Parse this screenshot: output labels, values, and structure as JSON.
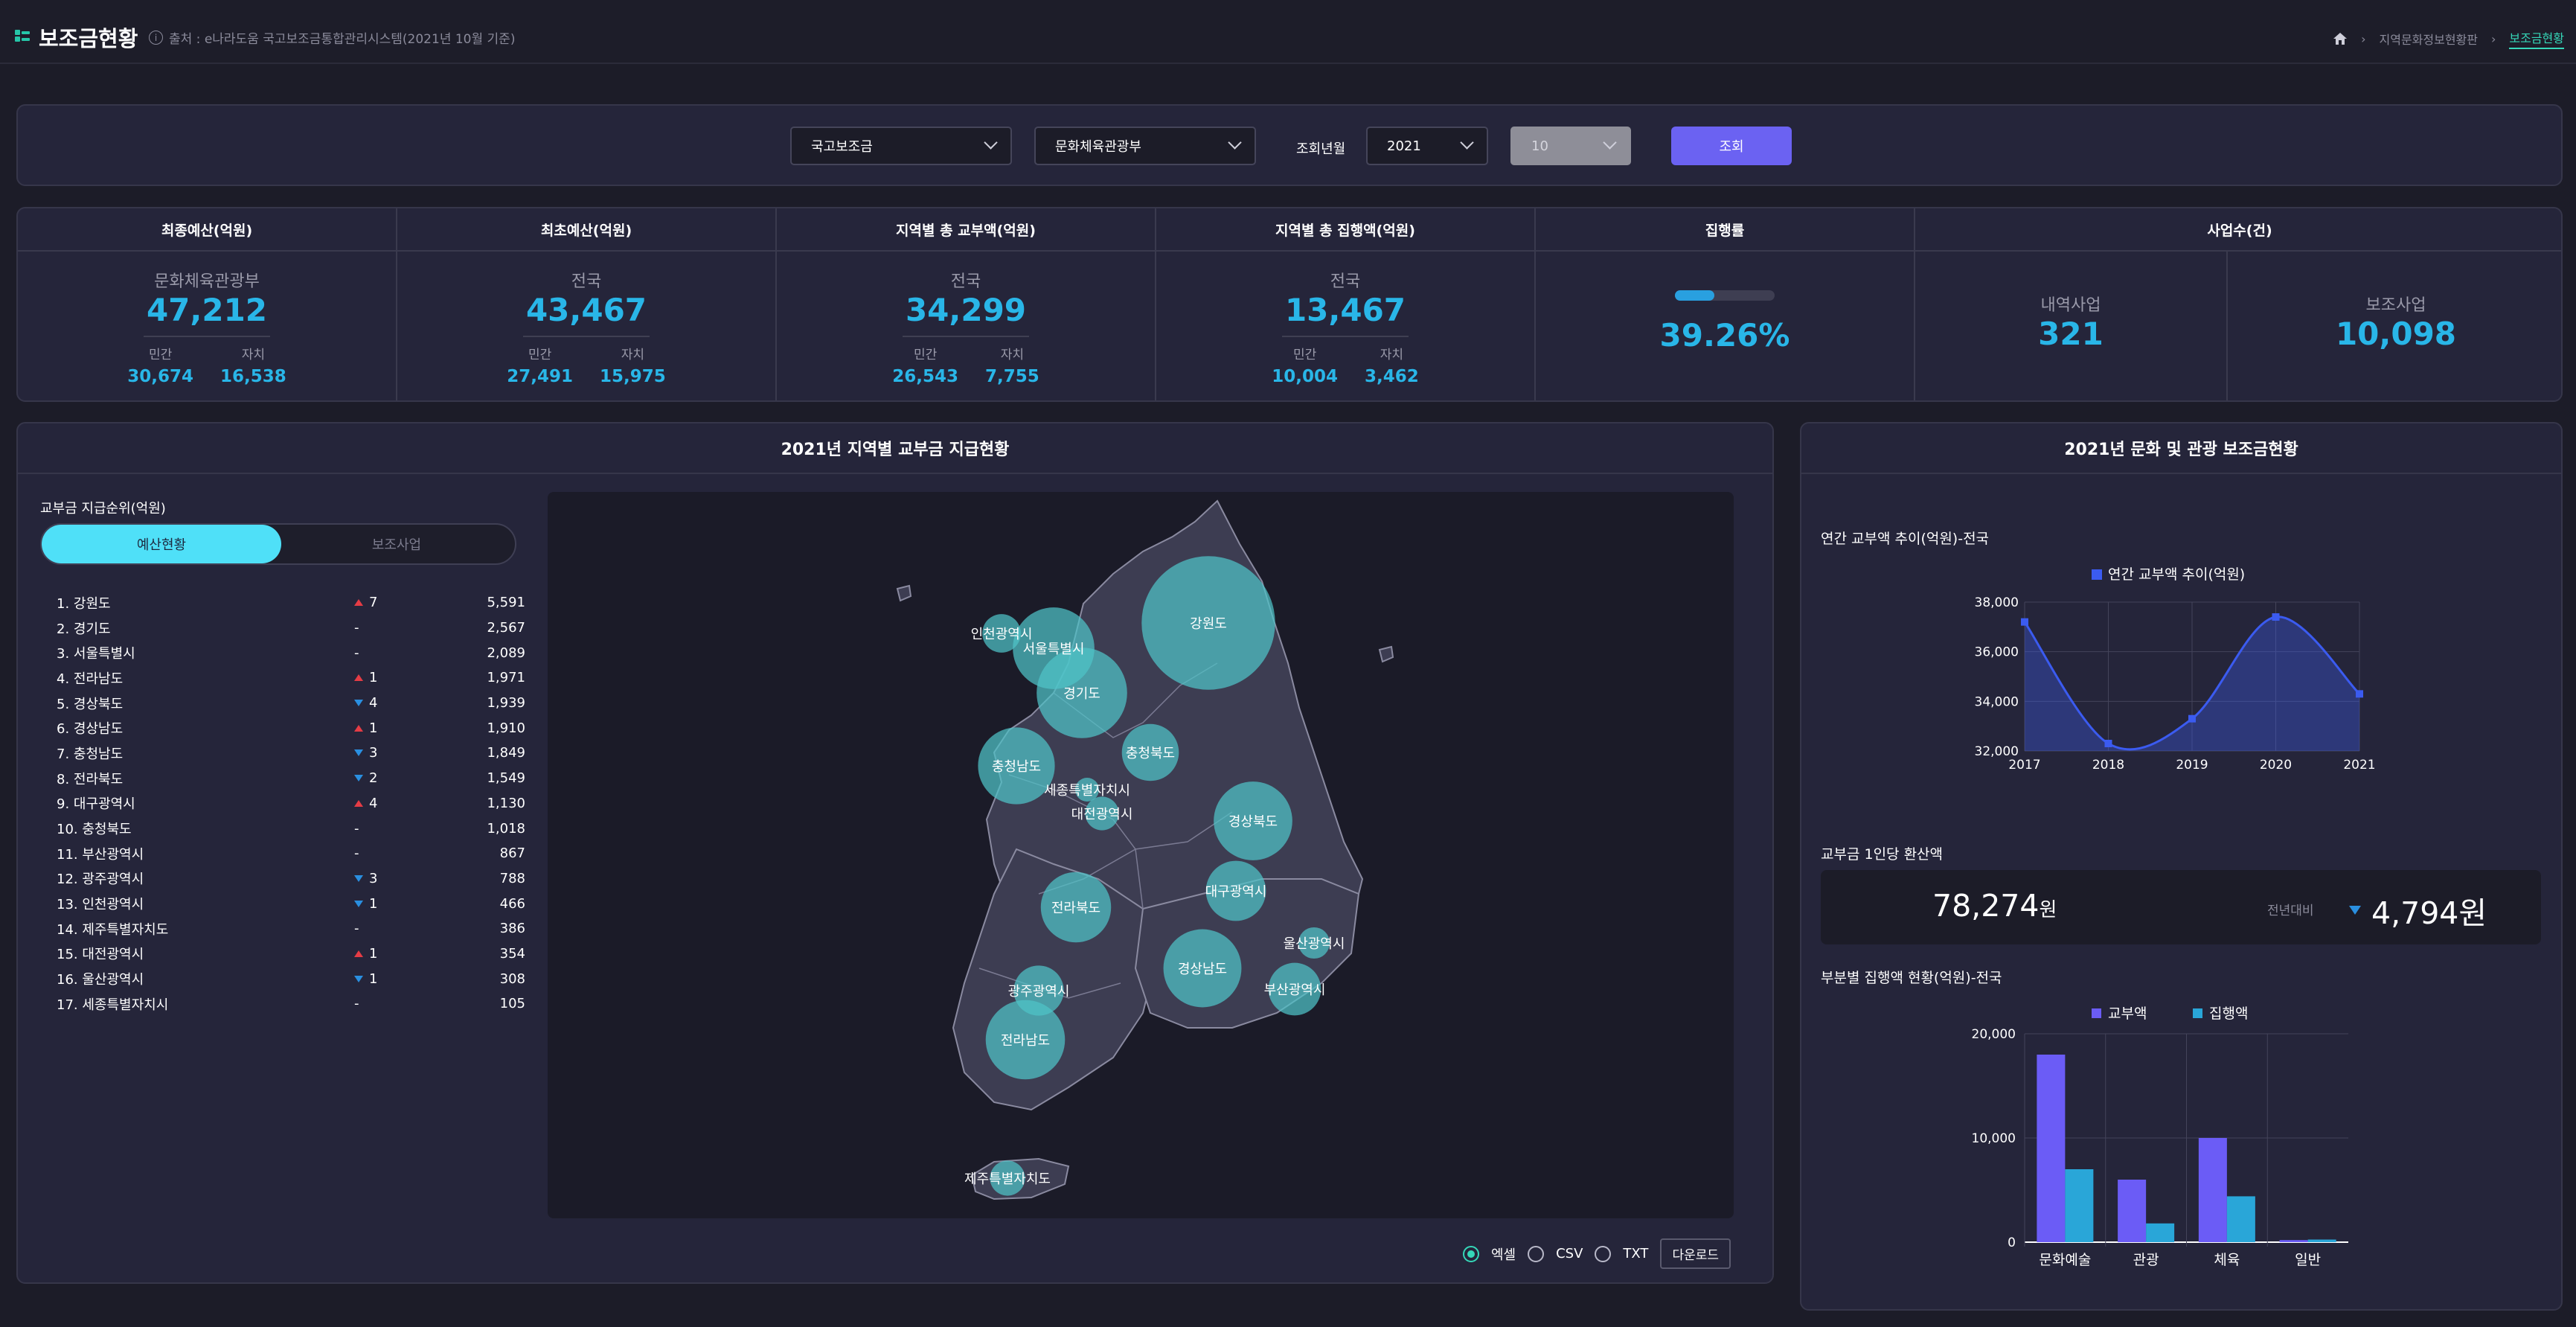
{
  "header": {
    "title": "보조금현황",
    "source": "출처 : e나라도움 국고보조금통합관리시스템(2021년 10월 기준)",
    "breadcrumb": [
      "지역문화정보현황판",
      "보조금현황"
    ]
  },
  "filters": {
    "category": "국고보조금",
    "ministry": "문화체육관광부",
    "period_label": "조회년월",
    "year": "2021",
    "month": "10",
    "query_button": "조회"
  },
  "stats": {
    "final_budget": {
      "header": "최종예산(억원)",
      "sub": "문화체육관광부",
      "value": "47,212",
      "left_label": "민간",
      "left_value": "30,674",
      "right_label": "자치",
      "right_value": "16,538"
    },
    "initial_budget": {
      "header": "최초예산(억원)",
      "sub": "전국",
      "value": "43,467",
      "left_label": "민간",
      "left_value": "27,491",
      "right_label": "자치",
      "right_value": "15,975"
    },
    "grant_total": {
      "header": "지역별 총 교부액(억원)",
      "sub": "전국",
      "value": "34,299",
      "left_label": "민간",
      "left_value": "26,543",
      "right_label": "자치",
      "right_value": "7,755"
    },
    "exec_total": {
      "header": "지역별 총 집행액(억원)",
      "sub": "전국",
      "value": "13,467",
      "left_label": "민간",
      "left_value": "10,004",
      "right_label": "자치",
      "right_value": "3,462"
    },
    "exec_rate": {
      "header": "집행률",
      "value": "39.26%",
      "fraction": 0.3926
    },
    "projects": {
      "header": "사업수(건)",
      "detail_label": "내역사업",
      "detail_value": "321",
      "sub_label": "보조사업",
      "sub_value": "10,098"
    }
  },
  "map_panel": {
    "title": "2021년 지역별 교부금 지급현황",
    "rank_title": "교부금 지급순위(억원)",
    "tab_budget": "예산현황",
    "tab_project": "보조사업",
    "ranking": [
      {
        "label": "1. 강원도",
        "dir": "up",
        "change": "7",
        "value": "5,591"
      },
      {
        "label": "2. 경기도",
        "dir": "none",
        "change": "-",
        "value": "2,567"
      },
      {
        "label": "3. 서울특별시",
        "dir": "none",
        "change": "-",
        "value": "2,089"
      },
      {
        "label": "4. 전라남도",
        "dir": "up",
        "change": "1",
        "value": "1,971"
      },
      {
        "label": "5. 경상북도",
        "dir": "down",
        "change": "4",
        "value": "1,939"
      },
      {
        "label": "6. 경상남도",
        "dir": "up",
        "change": "1",
        "value": "1,910"
      },
      {
        "label": "7. 충청남도",
        "dir": "down",
        "change": "3",
        "value": "1,849"
      },
      {
        "label": "8. 전라북도",
        "dir": "down",
        "change": "2",
        "value": "1,549"
      },
      {
        "label": "9. 대구광역시",
        "dir": "up",
        "change": "4",
        "value": "1,130"
      },
      {
        "label": "10. 충청북도",
        "dir": "none",
        "change": "-",
        "value": "1,018"
      },
      {
        "label": "11. 부산광역시",
        "dir": "none",
        "change": "-",
        "value": "867"
      },
      {
        "label": "12. 광주광역시",
        "dir": "down",
        "change": "3",
        "value": "788"
      },
      {
        "label": "13. 인천광역시",
        "dir": "down",
        "change": "1",
        "value": "466"
      },
      {
        "label": "14. 제주특별자치도",
        "dir": "none",
        "change": "-",
        "value": "386"
      },
      {
        "label": "15. 대전광역시",
        "dir": "up",
        "change": "1",
        "value": "354"
      },
      {
        "label": "16. 울산광역시",
        "dir": "down",
        "change": "1",
        "value": "308"
      },
      {
        "label": "17. 세종특별자치시",
        "dir": "none",
        "change": "-",
        "value": "105"
      }
    ],
    "map_labels": {
      "gangwon": "강원도",
      "incheon": "인천광역시",
      "seoul": "서울특별시",
      "gyeonggi": "경기도",
      "chungbuk": "충청북도",
      "chungnam": "충청남도",
      "sejong": "세종특별자치시",
      "daejeon": "대전광역시",
      "gyeongbuk": "경상북도",
      "daegu": "대구광역시",
      "jeonbuk": "전라북도",
      "ulsan": "울산광역시",
      "gyeongnam": "경상남도",
      "busan": "부산광역시",
      "gwangju": "광주광역시",
      "jeonnam": "전라남도",
      "jeju": "제주특별자치도"
    },
    "export_excel": "엑셀",
    "export_csv": "CSV",
    "export_txt": "TXT",
    "download": "다운로드"
  },
  "right_panel": {
    "title": "2021년 문화 및 관광 보조금현황",
    "trend_title": "연간 교부액 추이(억원)-전국",
    "per_capita_title": "교부금 1인당 환산액",
    "per_capita_value": "78,274",
    "per_capita_unit": "원",
    "yoy_label": "전년대비",
    "yoy_value": "4,794원",
    "sector_title": "부분별 집행액 현황(억원)-전국"
  },
  "chart_data": [
    {
      "type": "line",
      "title": "",
      "legend": [
        "연간 교부액 추이(억원)"
      ],
      "legend_position": "top",
      "x": [
        2017,
        2018,
        2019,
        2020,
        2021
      ],
      "series": [
        {
          "name": "연간 교부액 추이(억원)",
          "values": [
            37200,
            32300,
            33300,
            37400,
            34300
          ]
        }
      ],
      "ylim": [
        32000,
        38000
      ],
      "yticks": [
        32000,
        34000,
        36000,
        38000
      ],
      "ytick_labels": [
        "32,000",
        "34,000",
        "36,000",
        "38,000"
      ],
      "xtick_labels": [
        "2017",
        "2018",
        "2019",
        "2020",
        "2021"
      ],
      "grid": true,
      "color": "#3b5bf0"
    },
    {
      "type": "bar",
      "legend_position": "top",
      "categories": [
        "문화예술",
        "관광",
        "체육",
        "일반"
      ],
      "series": [
        {
          "name": "교부액",
          "values": [
            18000,
            6000,
            10000,
            200
          ],
          "color": "#6b5cf6"
        },
        {
          "name": "집행액",
          "values": [
            7000,
            1800,
            4400,
            250
          ],
          "color": "#29a6d8"
        }
      ],
      "ylim": [
        0,
        20000
      ],
      "yticks": [
        0,
        10000,
        20000
      ],
      "ytick_labels": [
        "0",
        "10,000",
        "20,000"
      ],
      "grid": true
    }
  ]
}
